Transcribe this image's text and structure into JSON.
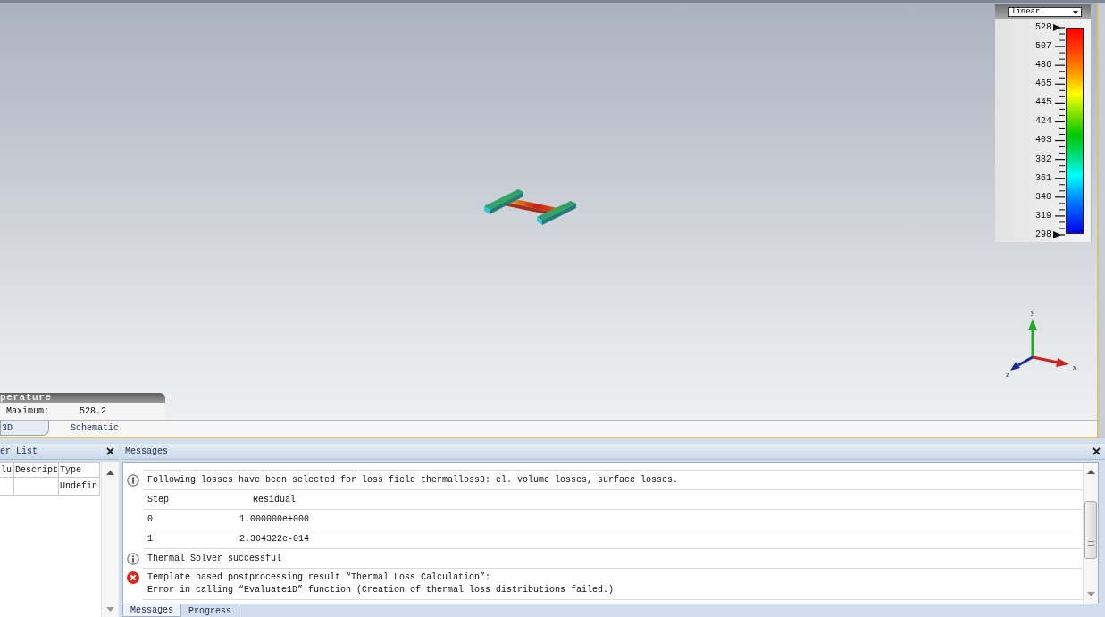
{
  "viewport": {
    "legend": {
      "scale_mode": "linear",
      "labels": [
        "528",
        "507",
        "486",
        "465",
        "445",
        "424",
        "403",
        "382",
        "361",
        "340",
        "319",
        "298"
      ]
    },
    "axes": [
      {
        "kind": "vertical",
        "label": "y",
        "color": "#1faa2a"
      },
      {
        "kind": "horizontal",
        "label": "x",
        "color": "#cc2222"
      },
      {
        "kind": "depth",
        "label": "z",
        "color": "#1a2a9a"
      }
    ],
    "result_overlay": {
      "title": "perature",
      "rows": [
        {
          "label": "Maximum:",
          "value": "528.2"
        }
      ]
    },
    "view_tabs": [
      {
        "label": "3D",
        "selected": true
      },
      {
        "label": "Schematic",
        "selected": false
      }
    ]
  },
  "parameter_list": {
    "title": "er List",
    "columns": [
      "lu",
      "Descript",
      "Type"
    ],
    "rows": [
      {
        "type": "Undefin"
      }
    ]
  },
  "messages": {
    "title": "Messages",
    "entries": [
      {
        "kind": "info",
        "lines": [
          "Following losses have been selected for loss field thermalloss3: el. volume losses, surface losses."
        ]
      },
      {
        "kind": "table_header",
        "cells": [
          "Step",
          "Residual"
        ]
      },
      {
        "kind": "table_row",
        "cells": [
          "0",
          "1.000000e+000"
        ]
      },
      {
        "kind": "table_row",
        "cells": [
          "1",
          "2.304322e-014"
        ]
      },
      {
        "kind": "info",
        "lines": [
          "Thermal Solver successful"
        ]
      },
      {
        "kind": "error",
        "lines": [
          "Template based postprocessing result “Thermal Loss Calculation”:",
          "Error in calling “Evaluate1D” function (Creation of thermal loss distributions failed.)"
        ]
      }
    ],
    "tabs": [
      {
        "label": "Messages",
        "selected": true
      },
      {
        "label": "Progress",
        "selected": false
      }
    ]
  }
}
